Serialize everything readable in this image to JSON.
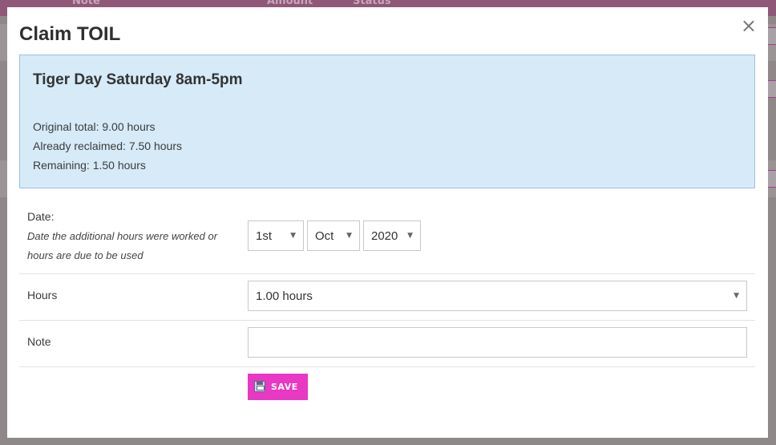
{
  "background": {
    "columns": [
      "Note",
      "Amount",
      "Status"
    ]
  },
  "modal": {
    "title": "Claim TOIL",
    "close_icon": "close-icon",
    "info": {
      "title": "Tiger Day Saturday 8am-5pm",
      "original_total": "Original total: 9.00 hours",
      "already_reclaimed": "Already reclaimed: 7.50 hours",
      "remaining": "Remaining: 1.50 hours"
    },
    "date": {
      "label": "Date:",
      "hint": "Date the additional hours were worked or hours are due to be used",
      "day": "1st",
      "month": "Oct",
      "year": "2020"
    },
    "hours": {
      "label": "Hours",
      "value": "1.00 hours"
    },
    "note": {
      "label": "Note",
      "value": ""
    },
    "save": {
      "label": "SAVE",
      "icon": "floppy-disk-icon"
    }
  },
  "colors": {
    "accent": "#e838c4",
    "info_bg": "#d6eaf8",
    "info_border": "#9ec2dc"
  }
}
